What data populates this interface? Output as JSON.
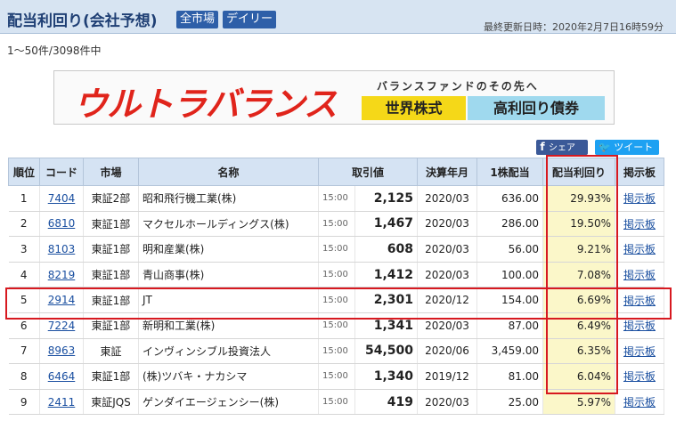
{
  "header": {
    "title": "配当利回り(会社予想)",
    "filters": [
      "全市場",
      "デイリー"
    ],
    "updated": "最終更新日時：2020年2月7日16時59分"
  },
  "count": "1〜50件/3098件中",
  "banner": {
    "logo": "ウルトラバランス",
    "sub": "バランスファンドのその先へ",
    "box1": "世界株式",
    "box2": "高利回り債券",
    "colors": {
      "logo": "#e0241b",
      "box1": "#f5d818",
      "box2": "#9fd9ee"
    }
  },
  "share": {
    "facebook_icon": "f",
    "facebook": "シェア",
    "twitter": "ツイート"
  },
  "table": {
    "headers": [
      "順位",
      "コード",
      "市場",
      "名称",
      "取引値",
      "決算年月",
      "1株配当",
      "配当利回り",
      "掲示板"
    ],
    "rows": [
      {
        "rank": "1",
        "code": "7404",
        "market": "東証2部",
        "name": "昭和飛行機工業(株)",
        "time": "15:00",
        "price": "2,125",
        "fy": "2020/03",
        "dps": "636.00",
        "yield": "29.93%",
        "board": "掲示板"
      },
      {
        "rank": "2",
        "code": "6810",
        "market": "東証1部",
        "name": "マクセルホールディングス(株)",
        "time": "15:00",
        "price": "1,467",
        "fy": "2020/03",
        "dps": "286.00",
        "yield": "19.50%",
        "board": "掲示板"
      },
      {
        "rank": "3",
        "code": "8103",
        "market": "東証1部",
        "name": "明和産業(株)",
        "time": "15:00",
        "price": "608",
        "fy": "2020/03",
        "dps": "56.00",
        "yield": "9.21%",
        "board": "掲示板"
      },
      {
        "rank": "4",
        "code": "8219",
        "market": "東証1部",
        "name": "青山商事(株)",
        "time": "15:00",
        "price": "1,412",
        "fy": "2020/03",
        "dps": "100.00",
        "yield": "7.08%",
        "board": "掲示板"
      },
      {
        "rank": "5",
        "code": "2914",
        "market": "東証1部",
        "name": "JT",
        "time": "15:00",
        "price": "2,301",
        "fy": "2020/12",
        "dps": "154.00",
        "yield": "6.69%",
        "board": "掲示板"
      },
      {
        "rank": "6",
        "code": "7224",
        "market": "東証1部",
        "name": "新明和工業(株)",
        "time": "15:00",
        "price": "1,341",
        "fy": "2020/03",
        "dps": "87.00",
        "yield": "6.49%",
        "board": "掲示板"
      },
      {
        "rank": "7",
        "code": "8963",
        "market": "東証",
        "name": "インヴィンシブル投資法人",
        "time": "15:00",
        "price": "54,500",
        "fy": "2020/06",
        "dps": "3,459.00",
        "yield": "6.35%",
        "board": "掲示板"
      },
      {
        "rank": "8",
        "code": "6464",
        "market": "東証1部",
        "name": "(株)ツバキ・ナカシマ",
        "time": "15:00",
        "price": "1,340",
        "fy": "2019/12",
        "dps": "81.00",
        "yield": "6.04%",
        "board": "掲示板"
      },
      {
        "rank": "9",
        "code": "2411",
        "market": "東証JQS",
        "name": "ゲンダイエージェンシー(株)",
        "time": "15:00",
        "price": "419",
        "fy": "2020/03",
        "dps": "25.00",
        "yield": "5.97%",
        "board": "掲示板"
      }
    ]
  },
  "highlight_color": "#d71920"
}
